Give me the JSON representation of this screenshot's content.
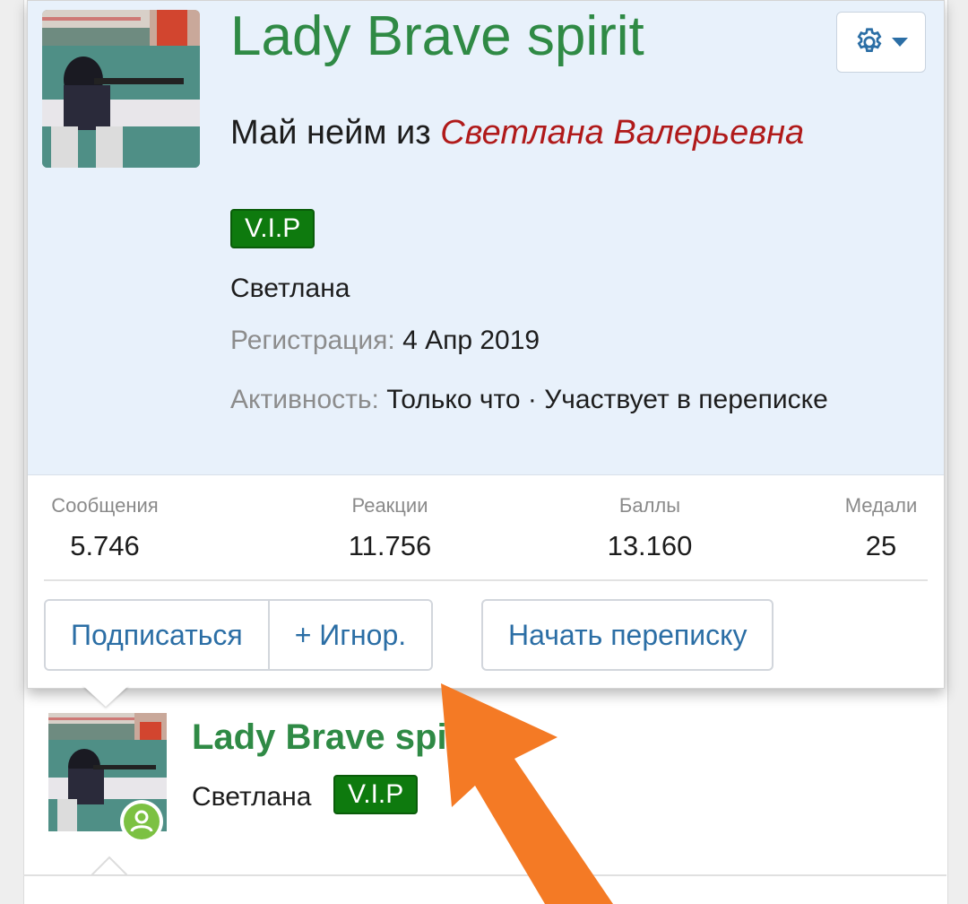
{
  "popup": {
    "username": "Lady Brave spirit",
    "title_prefix": "Май нейм из ",
    "title_name": "Светлана Валерьевна",
    "badge": "V.I.P",
    "real_name": "Светлана",
    "registration_label": "Регистрация:",
    "registration_value": "4 Апр 2019",
    "activity_label": "Активность:",
    "activity_value": "Только что · Участвует в переписке",
    "stats": [
      {
        "label": "Сообщения",
        "value": "5.746"
      },
      {
        "label": "Реакции",
        "value": "11.756"
      },
      {
        "label": "Баллы",
        "value": "13.160"
      },
      {
        "label": "Медали",
        "value": "25"
      }
    ],
    "buttons": {
      "follow": "Подписаться",
      "ignore": "+ Игнор.",
      "start_conversation": "Начать переписку"
    }
  },
  "card": {
    "username": "Lady Brave spi",
    "real_name": "Светлана",
    "badge": "V.I.P"
  },
  "icons": {
    "settings": "gear-icon",
    "dropdown": "caret-down-icon",
    "online": "user-online-icon",
    "annotation": "orange-arrow"
  },
  "colors": {
    "username": "#2f8a45",
    "badge_bg": "#0e7a0e",
    "link": "#2b6ea5",
    "highlight_name": "#b01a1a",
    "arrow": "#f47a25",
    "header_bg": "#e8f1fb"
  }
}
